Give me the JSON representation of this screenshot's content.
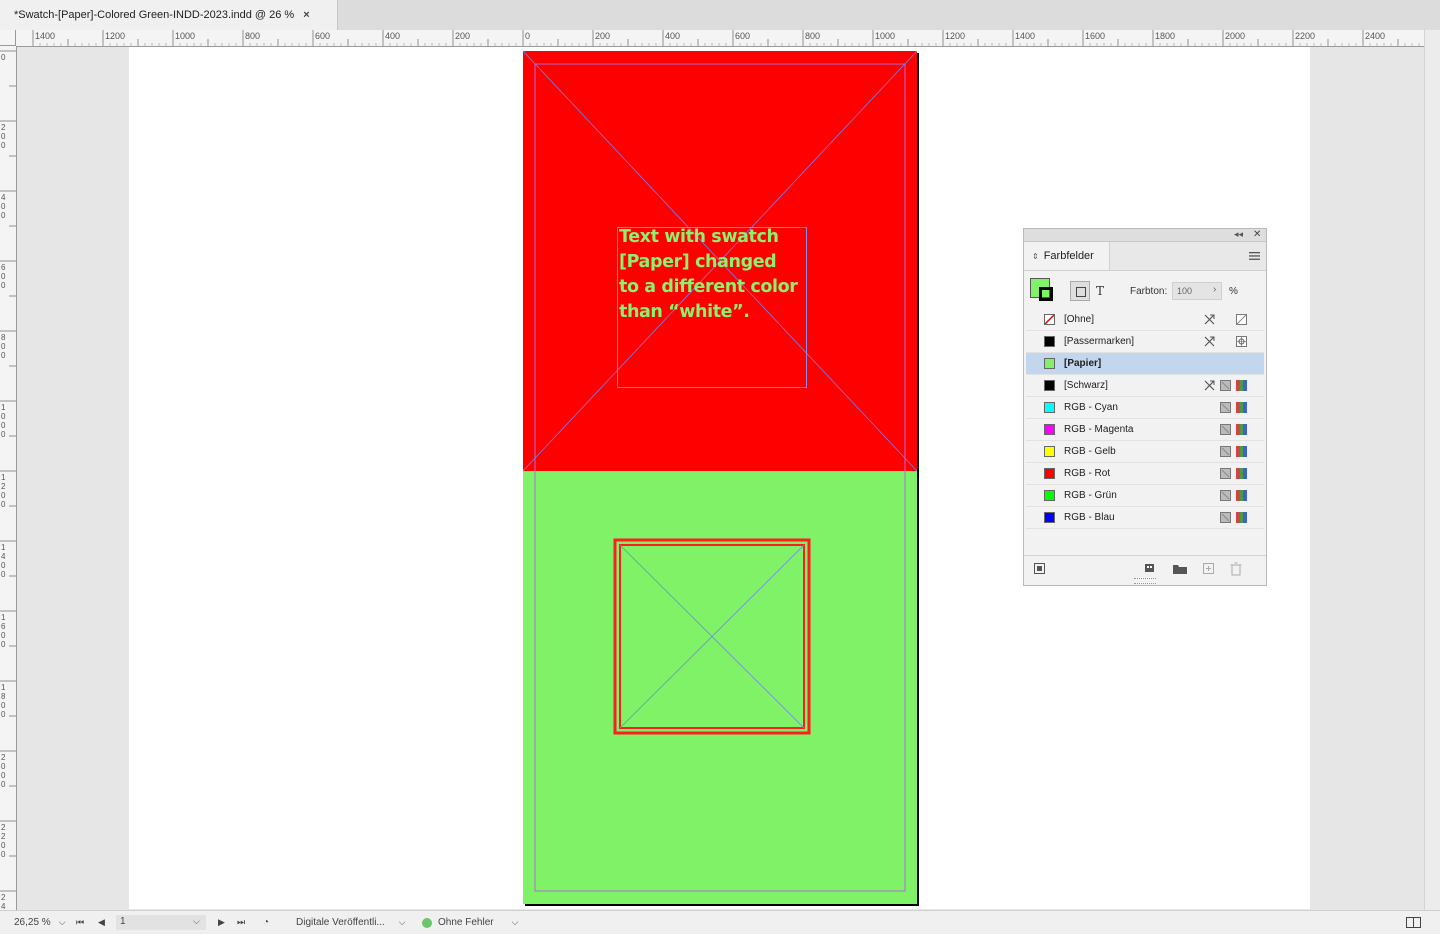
{
  "document_tab": {
    "title": "*Swatch-[Paper]-Colored Green-INDD-2023.indd @ 26 %",
    "close": "×"
  },
  "ruler": {
    "h_labels": [
      "1400",
      "1200",
      "1000",
      "800",
      "600",
      "400",
      "200",
      "0",
      "200",
      "400",
      "600",
      "800",
      "1000",
      "1200",
      "1400",
      "1600",
      "1800",
      "2000",
      "2200",
      "2400"
    ],
    "v_labels": [
      "0",
      "200",
      "400",
      "600",
      "800",
      "1000",
      "1200",
      "1400",
      "1600",
      "1800",
      "2000",
      "2200",
      "24"
    ]
  },
  "page": {
    "top_color": "#ff0000",
    "bottom_color": "#7ff267",
    "text_lines": [
      "Text with swatch",
      "[Paper] changed",
      "to a different color",
      "than “white”."
    ]
  },
  "status": {
    "zoom": "26,25 %",
    "page_number": "1",
    "preflight_profile": "Digitale Veröffentli...",
    "errors": "Ohne Fehler",
    "error_status_color": "#6cc46c"
  },
  "swatches_panel": {
    "title": "Farbfelder",
    "tint_label": "Farbton:",
    "tint_value": "100",
    "tint_unit": "%",
    "text_toggle": "T",
    "swatches": [
      {
        "name": "[Ohne]",
        "color": "none"
      },
      {
        "name": "[Passermarken]",
        "color": "#000000"
      },
      {
        "name": "[Papier]",
        "color": "#7ff267",
        "selected": true
      },
      {
        "name": "[Schwarz]",
        "color": "#000000"
      },
      {
        "name": "RGB - Cyan",
        "color": "#00ffff"
      },
      {
        "name": "RGB - Magenta",
        "color": "#ff00ff"
      },
      {
        "name": "RGB - Gelb",
        "color": "#ffff00"
      },
      {
        "name": "RGB - Rot",
        "color": "#ff0000"
      },
      {
        "name": "RGB - Grün",
        "color": "#00ff00"
      },
      {
        "name": "RGB - Blau",
        "color": "#0000ff"
      }
    ]
  }
}
